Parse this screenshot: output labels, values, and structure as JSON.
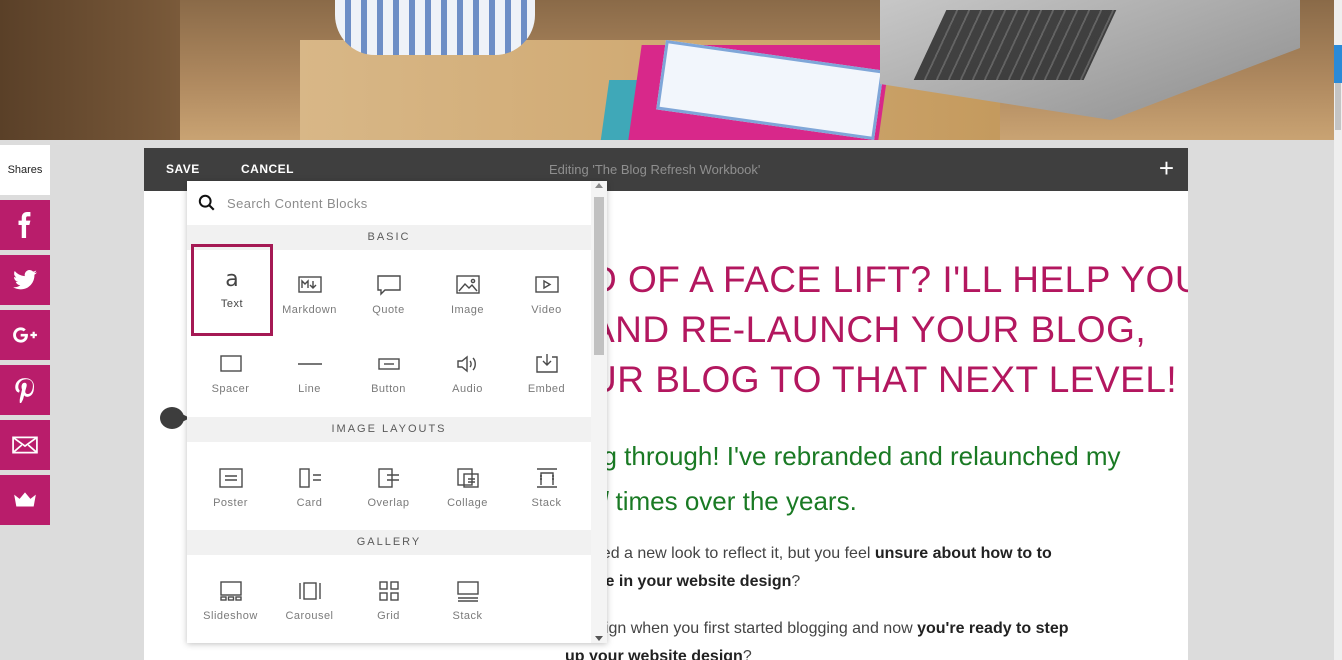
{
  "toolbar": {
    "save_label": "SAVE",
    "cancel_label": "CANCEL",
    "editing_label": "Editing 'The Blog Refresh Workbook'",
    "add_icon": "plus-icon"
  },
  "shares": {
    "label": "Shares",
    "networks": [
      "facebook-icon",
      "twitter-icon",
      "google-plus-icon",
      "pinterest-icon",
      "email-icon",
      "crown-icon"
    ]
  },
  "picker": {
    "search_placeholder": "Search Content Blocks",
    "sections": [
      {
        "title": "BASIC",
        "blocks": [
          "Text",
          "Markdown",
          "Quote",
          "Image",
          "Video",
          "Spacer",
          "Line",
          "Button",
          "Audio",
          "Embed"
        ]
      },
      {
        "title": "IMAGE LAYOUTS",
        "blocks": [
          "Poster",
          "Card",
          "Overlap",
          "Collage",
          "Stack"
        ]
      },
      {
        "title": "GALLERY",
        "blocks": [
          "Slideshow",
          "Carousel",
          "Grid",
          "Stack"
        ]
      }
    ],
    "selected_block": "Text"
  },
  "content": {
    "headline_lines": [
      "D OF A FACE LIFT? I'LL HELP YOU",
      "AND RE-LAUNCH YOUR BLOG,",
      "UR BLOG TO THAT NEXT LEVEL!"
    ],
    "sub_line1": "ng through! I've rebranded and relaunched my",
    "sub_line2_italic": "al",
    "sub_line2_rest": " times over the years.",
    "p1_line1_pre": "need a new look to reflect it, but you feel ",
    "p1_line1_bold": "unsure about how to to",
    "p1_line2_bold": "nge in your website design",
    "p1_line2_post": "?",
    "p2_line1_pre": "esign when you first started blogging and now ",
    "p2_line1_bold": "you're ready to step",
    "p2_line2_bold": "up your website design",
    "p2_line2_post": "?"
  },
  "colors": {
    "accent": "#b3175f",
    "green_text": "#1a7a24",
    "toolbar_bg": "#3f3f3f",
    "social_bg": "#b91d6b",
    "selected_border": "#a51954"
  }
}
